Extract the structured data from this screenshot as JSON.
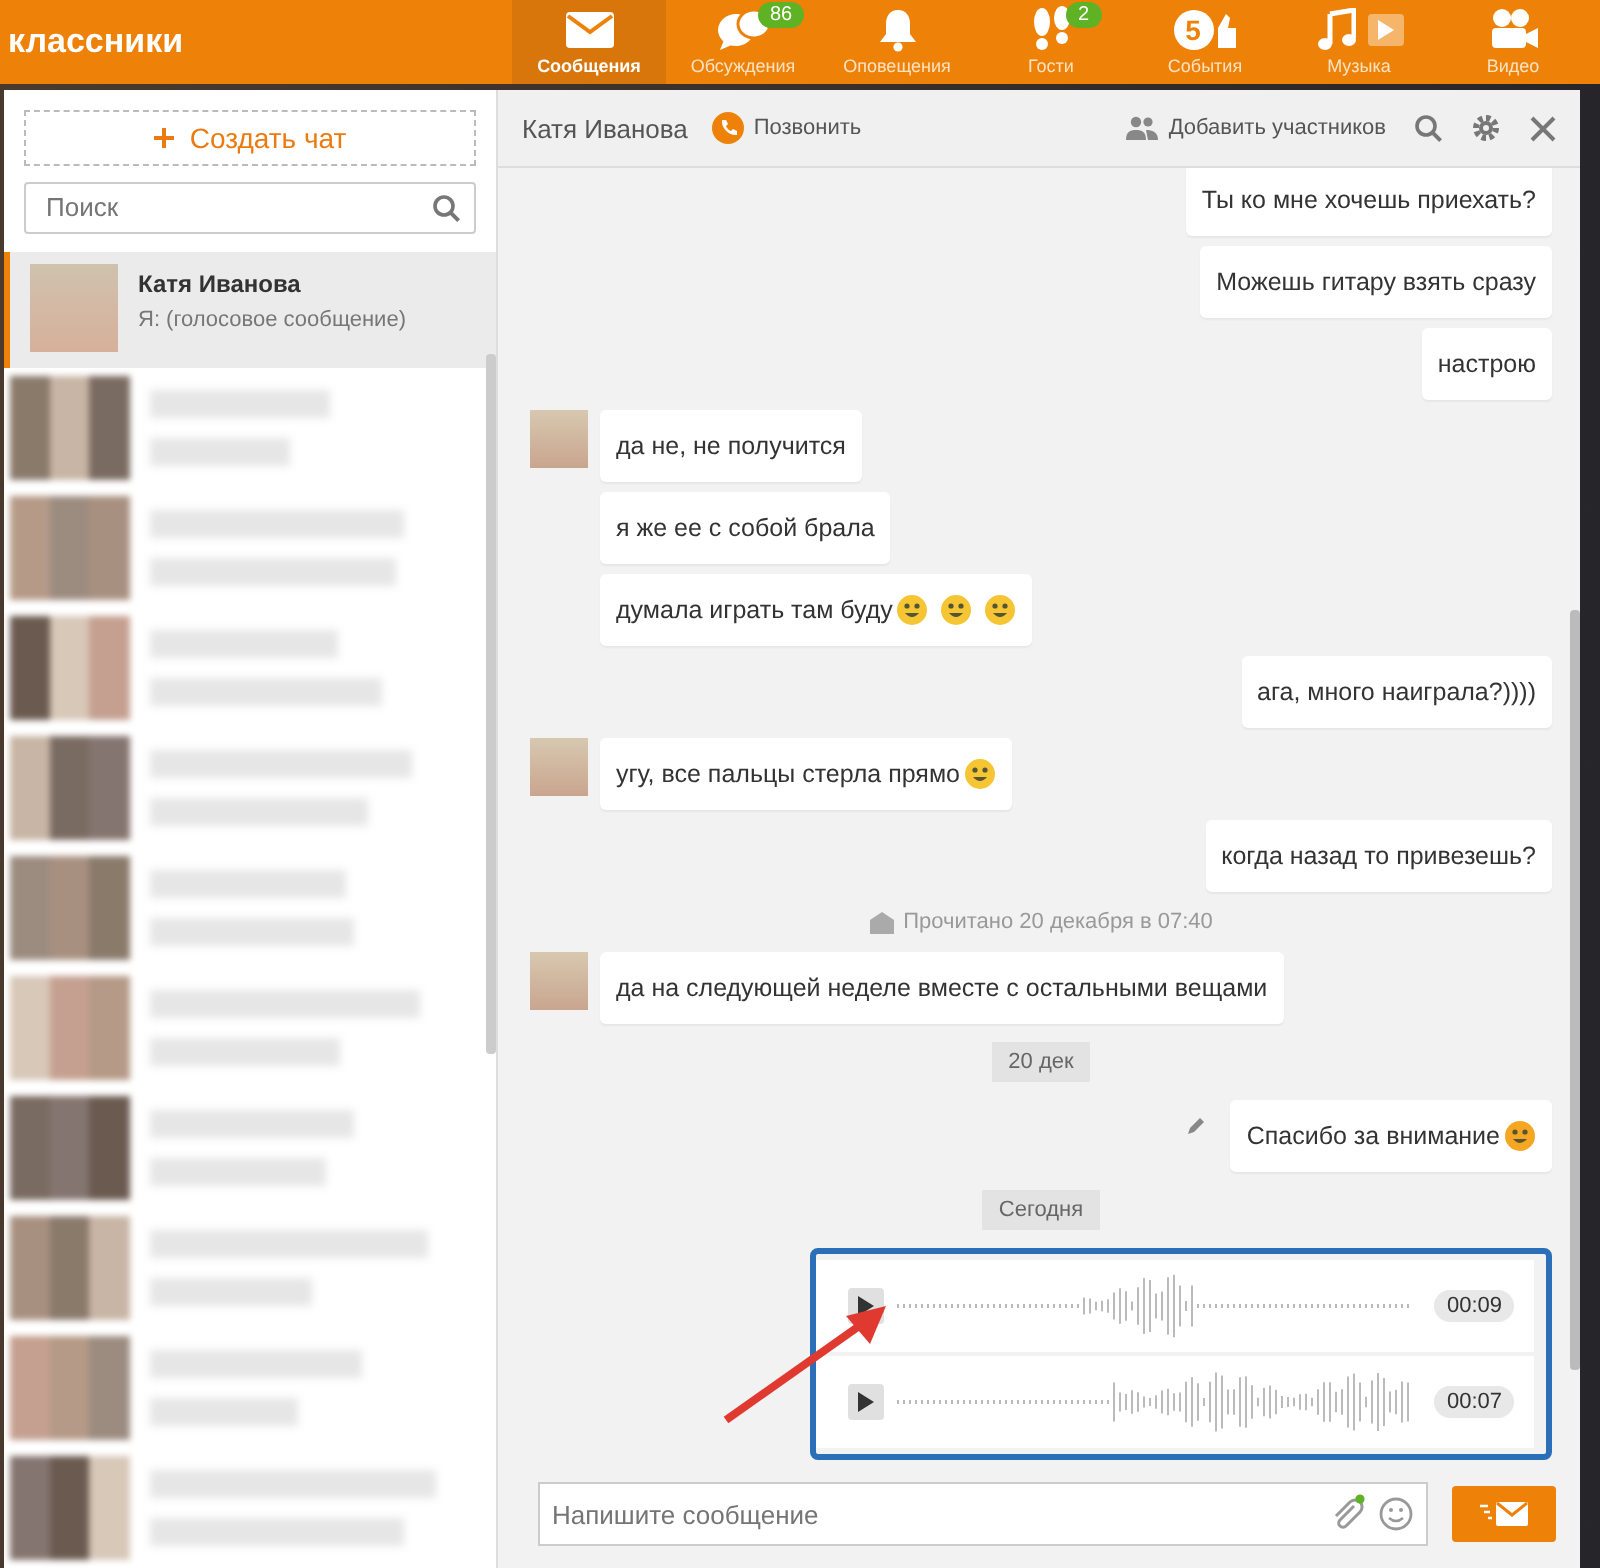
{
  "top_bar": {
    "logo": "классники",
    "nav": [
      {
        "kind": "mail",
        "label": "Сообщения",
        "selected": true
      },
      {
        "kind": "chat",
        "label": "Обсуждения",
        "badge": "86",
        "selected": false
      },
      {
        "kind": "bell",
        "label": "Оповещения",
        "selected": false
      },
      {
        "kind": "steps",
        "label": "Гости",
        "badge": "2",
        "selected": false
      },
      {
        "kind": "events",
        "label": "События",
        "icon_label": "5",
        "selected": false
      },
      {
        "kind": "music",
        "label": "Музыка",
        "selected": false
      },
      {
        "kind": "video",
        "label": "Видео",
        "selected": false
      }
    ]
  },
  "sidebar": {
    "create_button": "Создать чат",
    "search": {
      "placeholder": "Поиск"
    },
    "chats": [
      {
        "name": "Катя Иванова",
        "preview": "Я:  (голосовое сообщение)",
        "selected": true
      }
    ]
  },
  "chat": {
    "contact": "Катя Иванова",
    "call": "Позвонить",
    "add_members": "Добавить участников",
    "messages": [
      {
        "kind": "text",
        "outgoing": true,
        "text": "Ты ко мне хочешь приехать?"
      },
      {
        "kind": "text",
        "outgoing": true,
        "text": "Можешь гитару взять сразу"
      },
      {
        "kind": "text",
        "outgoing": true,
        "text": "настрою"
      },
      {
        "kind": "text",
        "outgoing": false,
        "avatar": true,
        "text": "да не, не получится"
      },
      {
        "kind": "text",
        "outgoing": false,
        "avatar": false,
        "text": "я же ее с собой брала"
      },
      {
        "kind": "text",
        "outgoing": false,
        "avatar": false,
        "text": "думала играть там буду",
        "emoji": [
          {
            "kind": "sweat"
          },
          {
            "kind": "sweat"
          },
          {
            "kind": "sweat"
          }
        ]
      },
      {
        "kind": "text",
        "outgoing": true,
        "text": "ага, много наиграла?))))"
      },
      {
        "kind": "text",
        "outgoing": false,
        "avatar": true,
        "text": "угу, все пальцы стерла прямо",
        "emoji": [
          {
            "kind": "laugh"
          }
        ]
      },
      {
        "kind": "text",
        "outgoing": true,
        "text": "когда назад то привезешь?"
      },
      {
        "kind": "status",
        "text": "Прочитано 20 декабря в 07:40"
      },
      {
        "kind": "text",
        "outgoing": false,
        "avatar": true,
        "text": "да на следующей неделе вместе с остальными вещами"
      },
      {
        "kind": "date",
        "text": "20 дек"
      },
      {
        "kind": "text",
        "outgoing": true,
        "edited": true,
        "text": "Спасибо за внимание",
        "emoji": [
          {
            "kind": "eyes"
          }
        ]
      },
      {
        "kind": "date",
        "text": "Сегодня"
      },
      {
        "kind": "voice",
        "duration": "00:09"
      },
      {
        "kind": "voice",
        "duration": "00:07"
      }
    ],
    "composer": {
      "placeholder": "Напишите сообщение"
    }
  }
}
